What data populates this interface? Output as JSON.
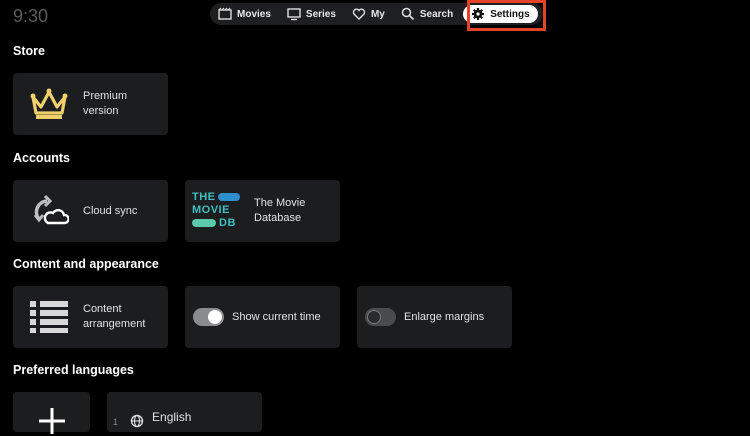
{
  "status": {
    "clock": "9:30"
  },
  "nav": {
    "movies": "Movies",
    "series": "Series",
    "my": "My",
    "search": "Search",
    "settings": "Settings"
  },
  "sections": {
    "store": "Store",
    "accounts": "Accounts",
    "content": "Content and appearance",
    "languages": "Preferred languages"
  },
  "store": {
    "premium_line1": "Premium",
    "premium_line2": "version"
  },
  "accounts": {
    "cloud_sync": "Cloud sync",
    "tmdb_line1": "The Movie",
    "tmdb_line2": "Database",
    "tmdb_logo_lines": [
      "THE",
      "MOVIE",
      "DB"
    ]
  },
  "content": {
    "arrangement_line1": "Content",
    "arrangement_line2": "arrangement",
    "show_time": {
      "label": "Show current time",
      "enabled": true
    },
    "enlarge_margins": {
      "label": "Enlarge margins",
      "enabled": false
    }
  },
  "languages": {
    "index": "1",
    "first": "English"
  },
  "colors": {
    "accent_highlight": "#e4432b",
    "crown": "#f1cf6b",
    "tmdb": "#3fbfc2"
  },
  "icons": [
    "film-icon",
    "tv-icon",
    "heart-icon",
    "search-icon",
    "gear-icon",
    "crown-icon",
    "cloud-sync-icon",
    "tmdb-logo",
    "list-icon",
    "plus-icon",
    "globe-icon"
  ]
}
